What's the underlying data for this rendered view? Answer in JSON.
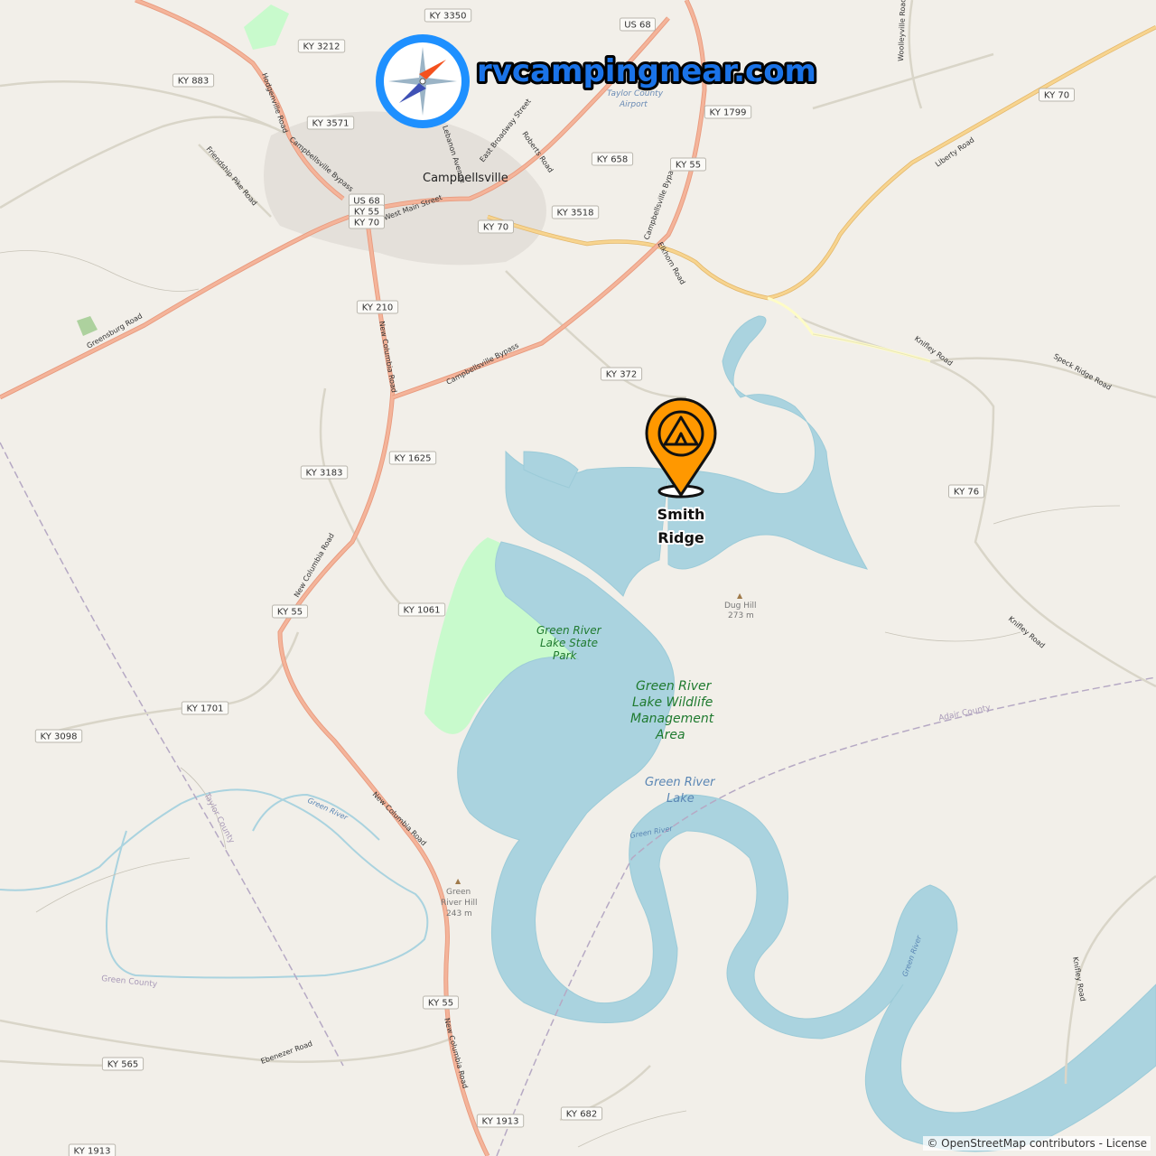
{
  "brand": {
    "site_name": "rvcampingnear.com",
    "icon": "compass-icon",
    "ring_color": "#1e90ff",
    "text_color": "#1a73e8"
  },
  "marker": {
    "icon": "camping-tent-pin-icon",
    "label_line1": "Smith",
    "label_line2": "Ridge",
    "color": "#ff9800"
  },
  "places": {
    "town": "Campbellsville",
    "airport_line1": "Taylor County",
    "airport_line2": "Airport"
  },
  "water": {
    "lake_line1": "Green River",
    "lake_line2": "Lake",
    "river_label": "Green River"
  },
  "parks": {
    "state_park_line1": "Green River",
    "state_park_line2": "Lake State",
    "state_park_line3": "Park",
    "wma_line1": "Green River",
    "wma_line2": "Lake Wildlife",
    "wma_line3": "Management",
    "wma_line4": "Area"
  },
  "peaks": {
    "dug_hill_name": "Dug Hill",
    "dug_hill_elev": "273 m",
    "grh_line1": "Green",
    "grh_line2": "River Hill",
    "grh_elev": "243 m"
  },
  "counties": {
    "adair": "Adair County",
    "taylor": "Taylor County",
    "green": "Green County"
  },
  "shields": {
    "ky3350": "KY 3350",
    "ky3212": "KY 3212",
    "us68_top": "US 68",
    "ky883": "KY 883",
    "ky3571": "KY 3571",
    "ky70_ne": "KY 70",
    "ky1799": "KY 1799",
    "ky658": "KY 658",
    "ky55_n": "KY 55",
    "multi1": "US 68",
    "multi2": "KY 55",
    "multi3": "KY 70",
    "ky3518": "KY 3518",
    "ky70_c": "KY 70",
    "ky210": "KY 210",
    "ky372": "KY 372",
    "ky1625": "KY 1625",
    "ky3183": "KY 3183",
    "ky76": "KY 76",
    "ky55_w": "KY 55",
    "ky1061": "KY 1061",
    "ky1701": "KY 1701",
    "ky3098": "KY 3098",
    "ky55_s": "KY 55",
    "ky565": "KY 565",
    "ky682": "KY 682",
    "ky1913_a": "KY 1913",
    "ky1913_b": "KY 1913"
  },
  "roads": {
    "hodgenville": "Hodgenville Road",
    "friendship": "Friendship Pike Road",
    "cbypass_nw": "Campbellsville Bypass",
    "west_main": "West Main Street",
    "east_broadway": "East Broadway Street",
    "roberts": "Roberts Road",
    "lebanon": "Lebanon Avenue",
    "cbypass_e": "Campbellsville Bypass",
    "elkhorn": "Elkhorn Road",
    "liberty": "Liberty Road",
    "woolleyville": "Woolleyville Road",
    "greensburg": "Greensburg Road",
    "new_columbia_n": "New Columbia Road",
    "cbypass_s": "Campbellsville Bypass",
    "knifley": "Knifley Road",
    "speck_ridge": "Speck Ridge Road",
    "new_columbia_w": "New Columbia Road",
    "knifley_s": "Knifley Road",
    "new_columbia_s": "New Columbia Road",
    "new_columbia_ss": "New Columbia Road",
    "ebenezer": "Ebenezer Road",
    "knifley_se": "Knifley Road",
    "green_river_w": "Green River",
    "green_river_e": "Green River"
  },
  "attribution": {
    "text": "© OpenStreetMap contributors - License"
  },
  "colors": {
    "land": "#f2efe9",
    "water": "#aad3df",
    "park": "#c8facc",
    "primary_road": "#f4b49a",
    "secondary_road": "#f7d48f",
    "tertiary_road": "#fefcc6",
    "state_border": "#9e9e9e"
  }
}
